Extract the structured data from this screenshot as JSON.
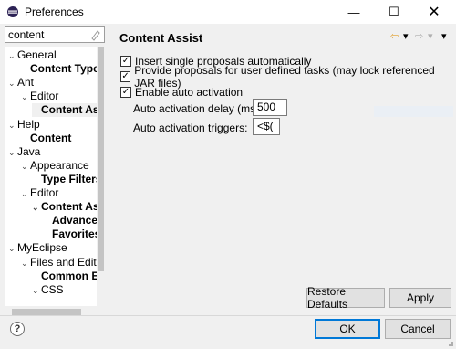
{
  "window": {
    "title": "Preferences",
    "icon": "eclipse-app-icon",
    "minimize_glyph": "—",
    "maximize_glyph": "☐",
    "close_glyph": "✕"
  },
  "filter": {
    "value": "content",
    "clear_icon": "clear-filter-icon"
  },
  "tree": {
    "items": [
      {
        "label": "General",
        "expanded": true,
        "bold": false
      },
      {
        "label": "Content Type",
        "bold": true
      },
      {
        "label": "Ant",
        "expanded": true,
        "bold": false
      },
      {
        "label": "Editor",
        "expanded": true,
        "bold": false
      },
      {
        "label": "Content Ass",
        "bold": true,
        "selected": true
      },
      {
        "label": "Help",
        "expanded": true,
        "bold": false
      },
      {
        "label": "Content",
        "bold": true
      },
      {
        "label": "Java",
        "expanded": true,
        "bold": false
      },
      {
        "label": "Appearance",
        "expanded": true,
        "bold": false
      },
      {
        "label": "Type Filters",
        "bold": true
      },
      {
        "label": "Editor",
        "expanded": true,
        "bold": false
      },
      {
        "label": "Content Ass",
        "bold": true,
        "expanded": true
      },
      {
        "label": "Advance",
        "bold": true
      },
      {
        "label": "Favorites",
        "bold": true
      },
      {
        "label": "MyEclipse",
        "expanded": true,
        "bold": false
      },
      {
        "label": "Files and Edito",
        "expanded": true,
        "bold": false
      },
      {
        "label": "Common E",
        "bold": true
      },
      {
        "label": "CSS",
        "expanded": true,
        "bold": false
      }
    ]
  },
  "panel": {
    "title": "Content Assist",
    "options": [
      {
        "label": "Insert single proposals automatically",
        "checked": true
      },
      {
        "label": "Provide proposals for user defined tasks (may lock referenced JAR files)",
        "checked": true
      },
      {
        "label": "Enable auto activation",
        "checked": true
      }
    ],
    "delay_label": "Auto activation delay (ms):",
    "delay_value": "500",
    "triggers_label": "Auto activation triggers:",
    "triggers_value": "<$("
  },
  "buttons": {
    "restore_defaults": "Restore Defaults",
    "apply": "Apply",
    "ok": "OK",
    "cancel": "Cancel",
    "help": "?"
  },
  "colors": {
    "accent": "#0078d7",
    "background": "#f0f0f0"
  }
}
